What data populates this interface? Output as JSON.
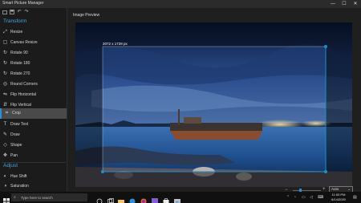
{
  "window": {
    "title": "Smart Picture Manager",
    "minimize": "—",
    "maximize": "☐",
    "close": "✕"
  },
  "toolbar": {
    "icons": [
      "open-file-icon",
      "save-icon",
      "undo-icon",
      "redo-icon"
    ]
  },
  "sidebar": {
    "transform_header": "Transform",
    "transform_items": [
      {
        "label": "Resize",
        "icon": "resize-icon"
      },
      {
        "label": "Canvas Resize",
        "icon": "canvas-resize-icon"
      },
      {
        "label": "Rotate 90",
        "icon": "rotate-icon"
      },
      {
        "label": "Rotate 180",
        "icon": "rotate-icon"
      },
      {
        "label": "Rotate 270",
        "icon": "rotate-icon"
      },
      {
        "label": "Round Corners",
        "icon": "round-corners-icon"
      },
      {
        "label": "Flip Horizontal",
        "icon": "flip-horizontal-icon"
      },
      {
        "label": "Flip Vertical",
        "icon": "flip-vertical-icon"
      },
      {
        "label": "Crop",
        "icon": "crop-icon",
        "selected": true
      },
      {
        "label": "Draw Text",
        "icon": "text-icon"
      },
      {
        "label": "Draw",
        "icon": "pen-icon"
      },
      {
        "label": "Shape",
        "icon": "shape-icon"
      },
      {
        "label": "Pan",
        "icon": "pan-icon"
      }
    ],
    "adjust_header": "Adjust",
    "adjust_items": [
      {
        "label": "Hue Shift",
        "icon": "hue-icon"
      },
      {
        "label": "Saturation",
        "icon": "saturation-icon"
      }
    ]
  },
  "main": {
    "preview_label": "Image Preview",
    "crop_size_label": "2072 x 1728 px",
    "zoom": {
      "minus": "−",
      "plus": "+",
      "value": "Auto",
      "level": 0.25
    }
  },
  "taskbar": {
    "search_placeholder": "Type here to search",
    "apps": [
      "start-icon",
      "task-view-icon",
      "file-explorer-icon",
      "edge-icon",
      "store-icon",
      "firefox-icon",
      "visual-studio-icon",
      "mail-icon",
      "picture-manager-icon"
    ],
    "time": "11:00 PM",
    "date": "6/14/2020"
  },
  "colors": {
    "accent": "#2d8fd5",
    "section_header": "#4aa3df",
    "crop_handle": "#1e90c8"
  }
}
